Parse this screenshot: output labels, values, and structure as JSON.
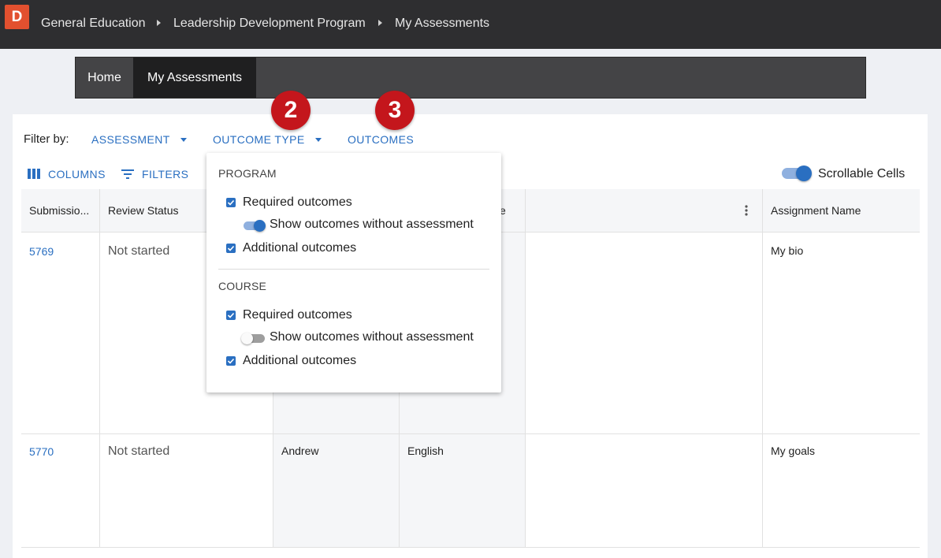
{
  "header": {
    "logo": "D",
    "breadcrumbs": [
      "General Education",
      "Leadership Development Program",
      "My Assessments"
    ]
  },
  "nav": {
    "items": [
      "Home",
      "My Assessments"
    ],
    "active": "My Assessments"
  },
  "filters": {
    "label": "Filter by:",
    "assessment": "ASSESSMENT",
    "outcome_type": "OUTCOME TYPE",
    "outcomes": "OUTCOMES"
  },
  "badges": [
    "2",
    "3"
  ],
  "toolbar": {
    "columns": "COLUMNS",
    "filters": "FILTERS",
    "scrollable_cells": "Scrollable Cells",
    "scrollable_on": true
  },
  "grid": {
    "columns": [
      "Submissio...",
      "Review Status",
      "",
      "e",
      "",
      "Assignment Name"
    ],
    "rows": [
      {
        "id": "5769",
        "status": "Not started",
        "name": "",
        "subject": "",
        "blank": "",
        "assignment": "My bio"
      },
      {
        "id": "5770",
        "status": "Not started",
        "name": "Andrew",
        "subject": "English",
        "blank": "",
        "assignment": "My goals"
      }
    ]
  },
  "dropdown": {
    "program": {
      "title": "PROGRAM",
      "required": "Required outcomes",
      "show_without": "Show outcomes without assessment",
      "show_without_on": true,
      "additional": "Additional outcomes"
    },
    "course": {
      "title": "COURSE",
      "required": "Required outcomes",
      "show_without": "Show outcomes without assessment",
      "show_without_on": false,
      "additional": "Additional outcomes"
    }
  },
  "colors": {
    "accent": "#2a6fc1",
    "badge": "#c4161c",
    "logo": "#e2502f"
  }
}
